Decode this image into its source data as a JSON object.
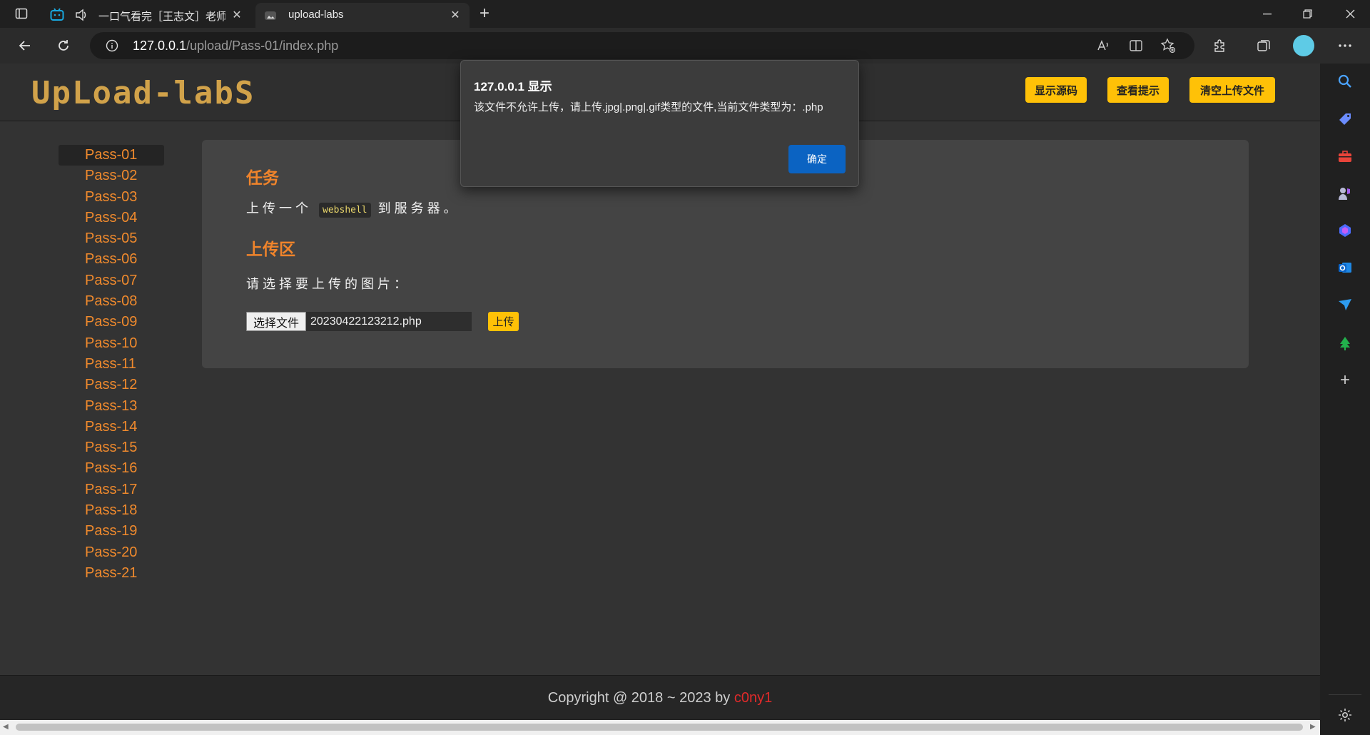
{
  "browser": {
    "tabs": [
      {
        "title": "一口气看完［王志文］老师"
      },
      {
        "title": "upload-labs"
      }
    ],
    "address": {
      "host": "127.0.0.1",
      "path": "/upload/Pass-01/index.php"
    }
  },
  "header": {
    "logo": "UpLoad-labS",
    "buttons": [
      "显示源码",
      "查看提示",
      "清空上传文件"
    ]
  },
  "sidebar": {
    "items": [
      "Pass-01",
      "Pass-02",
      "Pass-03",
      "Pass-04",
      "Pass-05",
      "Pass-06",
      "Pass-07",
      "Pass-08",
      "Pass-09",
      "Pass-10",
      "Pass-11",
      "Pass-12",
      "Pass-13",
      "Pass-14",
      "Pass-15",
      "Pass-16",
      "Pass-17",
      "Pass-18",
      "Pass-19",
      "Pass-20",
      "Pass-21"
    ]
  },
  "main": {
    "task_title": "任务",
    "task_before": "上传一个",
    "task_code": "webshell",
    "task_after": "到服务器。",
    "upload_title": "上传区",
    "upload_prompt": "请选择要上传的图片：",
    "file_button": "选择文件",
    "file_name": "20230422123212.php",
    "upload_button": "上传"
  },
  "footer": {
    "text": "Copyright @ 2018 ~ 2023 by ",
    "author": "c0ny1"
  },
  "dialog": {
    "title": "127.0.0.1 显示",
    "message": "该文件不允许上传，请上传.jpg|.png|.gif类型的文件,当前文件类型为：.php",
    "ok": "确定"
  },
  "colors": {
    "accent_orange": "#f08a2d",
    "button_yellow": "#ffc107",
    "dialog_blue": "#0b63c2",
    "author_red": "#e02a2a"
  }
}
